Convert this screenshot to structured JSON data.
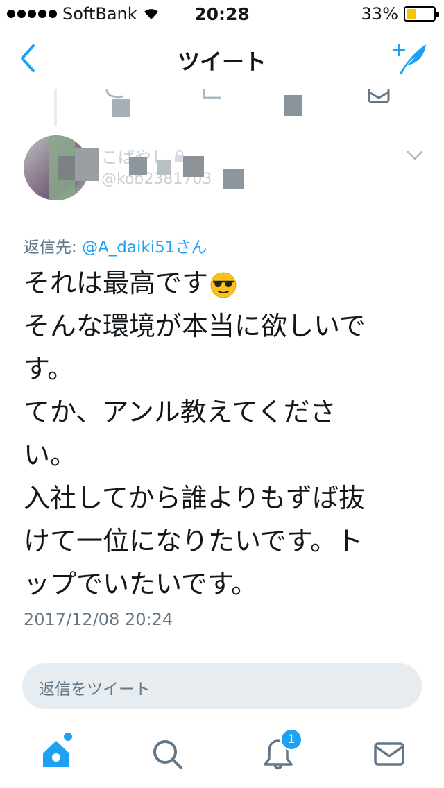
{
  "status_bar": {
    "carrier": "SoftBank",
    "time": "20:28",
    "battery_percent_text": "33%",
    "battery_level": 0.33,
    "battery_color": "#f5c500"
  },
  "nav": {
    "title": "ツイート",
    "back_icon": "chevron-left-icon",
    "compose_icon": "compose-tweet-icon"
  },
  "tweet": {
    "display_name": "こばやし",
    "handle": "@kob2381703",
    "reply_to_label": "返信先:",
    "reply_to_mention": "@A_daiki51さん",
    "text_lines": [
      "それは最高です",
      "そんな環境が本当に欲しいで",
      "す。",
      "てか、アンル教えてくださ",
      "い。",
      "入社してから誰よりもずば抜",
      "けて一位になりたいです。ト",
      "ップでいたいです。"
    ],
    "emoji": "smiling-face-with-sunglasses",
    "timestamp": "2017/12/08 20:24"
  },
  "reply_bar": {
    "placeholder": "返信をツイート"
  },
  "tab_bar": {
    "items": [
      {
        "name": "home",
        "icon": "home-icon"
      },
      {
        "name": "search",
        "icon": "search-icon"
      },
      {
        "name": "notifications",
        "icon": "bell-icon",
        "badge": "1"
      },
      {
        "name": "messages",
        "icon": "mail-icon"
      }
    ]
  },
  "colors": {
    "accent": "#1da1f2",
    "text_primary": "#14171a",
    "text_secondary": "#657786",
    "divider": "#e1e8ed"
  }
}
